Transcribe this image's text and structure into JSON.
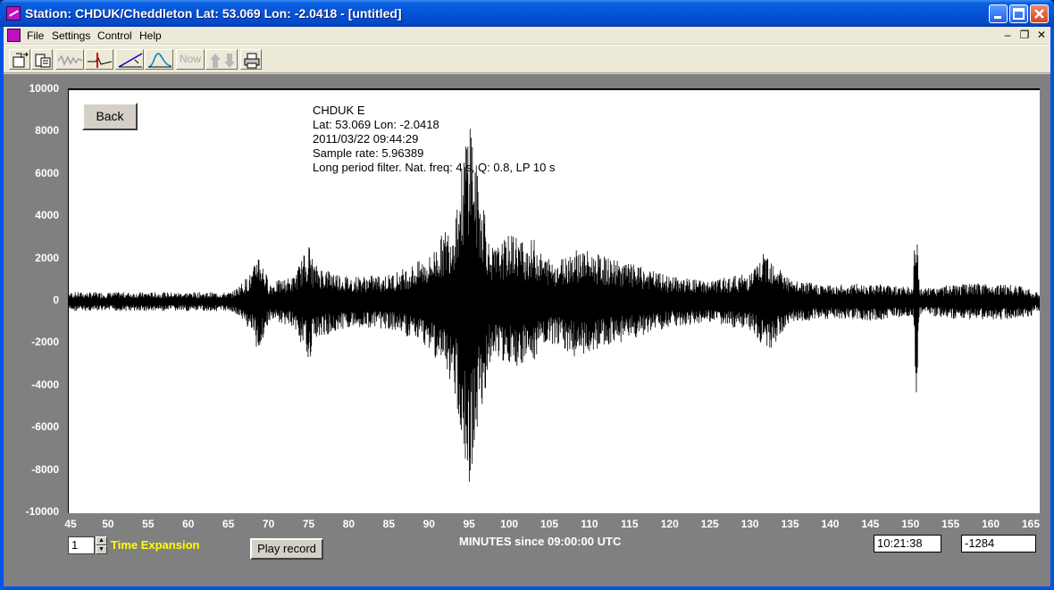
{
  "window": {
    "title": "Station: CHDUK/Cheddleton Lat: 53.069 Lon: -2.0418 - [untitled]"
  },
  "menu": {
    "items": [
      "File",
      "Settings",
      "Control",
      "Help"
    ]
  },
  "toolbar": {
    "now_label": "Now",
    "icons": [
      "open-file-icon",
      "save-file-icon",
      "waveform-icon",
      "pick-marker-icon",
      "slope-filter-icon",
      "spectrum-icon",
      "now-button",
      "up-down-arrows-icon",
      "print-icon"
    ]
  },
  "plot": {
    "back_label": "Back",
    "info": {
      "station": "CHDUK  E",
      "location": "Lat: 53.069 Lon: -2.0418",
      "datetime": "2011/03/22 09:44:29",
      "sample_rate": "Sample rate: 5.96389",
      "filter": "Long period filter. Nat. freq: 4 s, Q: 0.8, LP 10 s"
    },
    "x_axis_title": "MINUTES since 09:00:00 UTC"
  },
  "controls": {
    "time_expansion_value": "1",
    "time_expansion_label": "Time Expansion",
    "play_label": "Play record",
    "time_readout": "10:21:38",
    "value_readout": "-1284"
  },
  "colors": {
    "workspace": "#808080",
    "trace": "#000000",
    "axis_text": "#ffffff",
    "time_expansion_text": "#ffff00"
  },
  "chart_data": {
    "type": "line",
    "xlabel": "MINUTES since 09:00:00 UTC",
    "ylabel": "",
    "xlim": [
      45,
      166
    ],
    "ylim": [
      -10000,
      10000
    ],
    "x_ticks": [
      "45",
      "50",
      "55",
      "60",
      "65",
      "70",
      "75",
      "80",
      "85",
      "90",
      "95",
      "100",
      "105",
      "110",
      "115",
      "120",
      "125",
      "130",
      "135",
      "140",
      "145",
      "150",
      "155",
      "160",
      "165"
    ],
    "y_ticks": [
      "10000",
      "8000",
      "6000",
      "4000",
      "2000",
      "0",
      "-2000",
      "-4000",
      "-6000",
      "-8000",
      "-10000"
    ],
    "series": [
      {
        "points": [
          [
            45,
            0
          ],
          [
            50,
            -300
          ],
          [
            55,
            350
          ],
          [
            60,
            -250
          ],
          [
            65,
            300
          ],
          [
            68,
            1500
          ],
          [
            68.5,
            -2600
          ],
          [
            70,
            900
          ],
          [
            73,
            -1200
          ],
          [
            75,
            2800
          ],
          [
            75.5,
            -1800
          ],
          [
            80,
            1200
          ],
          [
            85,
            -1300
          ],
          [
            88,
            1800
          ],
          [
            90,
            -2200
          ],
          [
            92,
            3500
          ],
          [
            92.8,
            -3800
          ],
          [
            93.6,
            5500
          ],
          [
            94.2,
            -7000
          ],
          [
            94.6,
            8600
          ],
          [
            95,
            -9500
          ],
          [
            95.4,
            8200
          ],
          [
            95.8,
            -6500
          ],
          [
            96.3,
            5200
          ],
          [
            96.8,
            -5000
          ],
          [
            97.3,
            3000
          ],
          [
            98,
            -2500
          ],
          [
            100,
            3200
          ],
          [
            100.5,
            -3300
          ],
          [
            102,
            2800
          ],
          [
            103,
            -3000
          ],
          [
            104,
            2200
          ],
          [
            106,
            -2000
          ],
          [
            108,
            2600
          ],
          [
            110,
            -2400
          ],
          [
            112,
            2100
          ],
          [
            115,
            -1800
          ],
          [
            120,
            1200
          ],
          [
            125,
            -1000
          ],
          [
            130,
            1400
          ],
          [
            132,
            -2500
          ],
          [
            135,
            1000
          ],
          [
            140,
            -800
          ],
          [
            145,
            900
          ],
          [
            150.2,
            -700
          ],
          [
            150.5,
            4000
          ],
          [
            150.7,
            -4500
          ],
          [
            151,
            600
          ],
          [
            155,
            -800
          ],
          [
            160,
            900
          ],
          [
            165,
            -700
          ]
        ]
      }
    ]
  }
}
